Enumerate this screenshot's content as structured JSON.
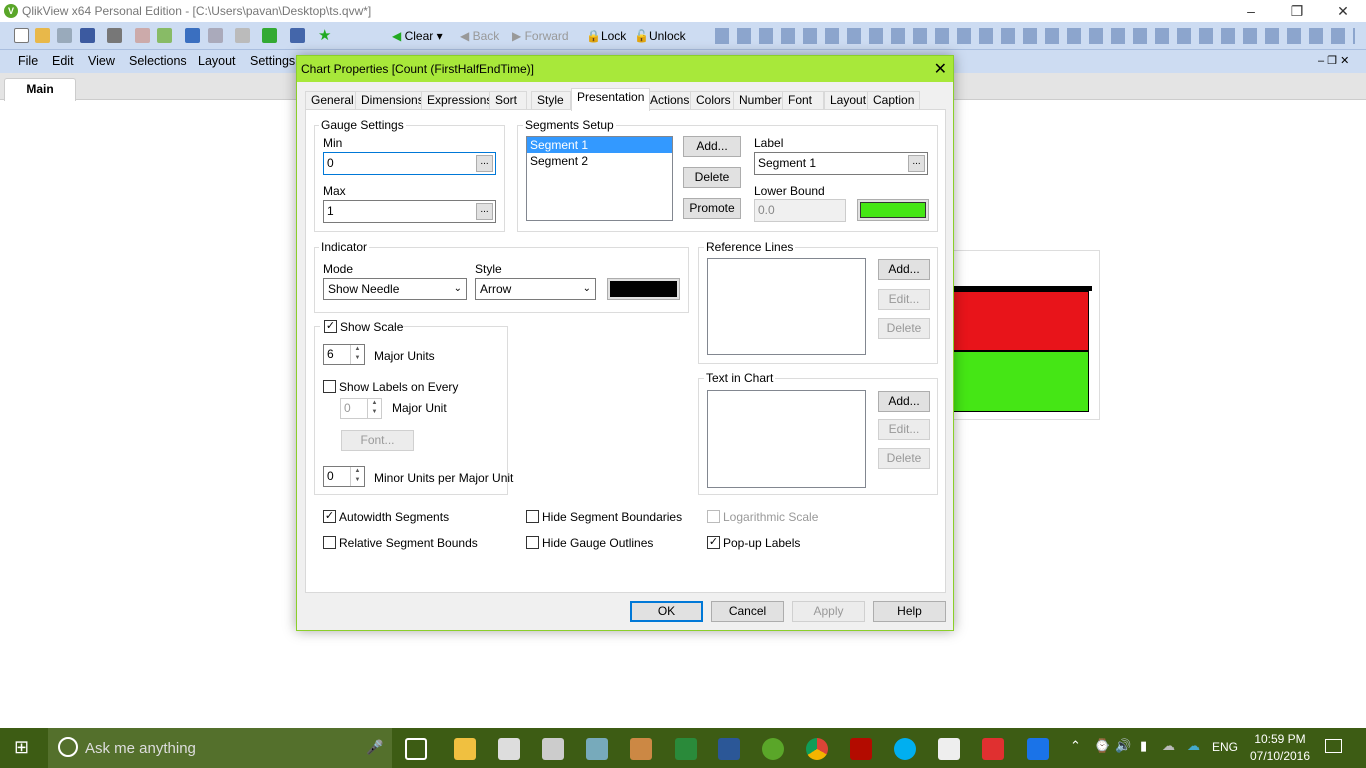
{
  "window": {
    "title": "QlikView x64 Personal Edition - [C:\\Users\\pavan\\Desktop\\ts.qvw*]",
    "logo": "V"
  },
  "toolbar": {
    "clear": "Clear",
    "back": "Back",
    "forward": "Forward",
    "lock": "Lock",
    "unlock": "Unlock"
  },
  "menu": [
    "File",
    "Edit",
    "View",
    "Selections",
    "Layout",
    "Settings"
  ],
  "sheet_tab": "Main",
  "dialog": {
    "title": "Chart Properties [Count (FirstHalfEndTime)]",
    "tabs": [
      "General",
      "Dimensions",
      "Expressions",
      "Sort",
      "Style",
      "Presentation",
      "Actions",
      "Colors",
      "Number",
      "Font",
      "Layout",
      "Caption"
    ],
    "active_tab": "Presentation",
    "gauge": {
      "legend": "Gauge Settings",
      "min_label": "Min",
      "min": "0",
      "max_label": "Max",
      "max": "1"
    },
    "segments": {
      "legend": "Segments Setup",
      "items": [
        "Segment 1",
        "Segment 2"
      ],
      "add": "Add...",
      "delete": "Delete",
      "promote": "Promote",
      "label_label": "Label",
      "label": "Segment 1",
      "lower_label": "Lower Bound",
      "lower": "0.0",
      "color": "#45e615"
    },
    "indicator": {
      "legend": "Indicator",
      "mode_label": "Mode",
      "mode": "Show Needle",
      "style_label": "Style",
      "style": "Arrow",
      "color": "#000000"
    },
    "scale": {
      "show_scale": "Show Scale",
      "major_units": "6",
      "major_units_label": "Major Units",
      "show_labels": "Show Labels on Every",
      "label_unit": "0",
      "major_unit_label": "Major Unit",
      "font": "Font...",
      "minor_units": "0",
      "minor_label": "Minor Units per Major Unit"
    },
    "reference_lines": {
      "legend": "Reference Lines",
      "add": "Add...",
      "edit": "Edit...",
      "delete": "Delete"
    },
    "text_in_chart": {
      "legend": "Text in Chart",
      "add": "Add...",
      "edit": "Edit...",
      "delete": "Delete"
    },
    "options": {
      "autowidth": "Autowidth Segments",
      "relative": "Relative Segment Bounds",
      "hide_boundaries": "Hide Segment Boundaries",
      "hide_outlines": "Hide Gauge Outlines",
      "log": "Logarithmic Scale",
      "popup": "Pop-up Labels"
    },
    "buttons": {
      "ok": "OK",
      "cancel": "Cancel",
      "apply": "Apply",
      "help": "Help"
    }
  },
  "chart_colors": {
    "top": "#e8141a",
    "bottom": "#45e615"
  },
  "taskbar": {
    "search": "Ask me anything",
    "lang": "ENG",
    "time": "10:59 PM",
    "date": "07/10/2016"
  }
}
